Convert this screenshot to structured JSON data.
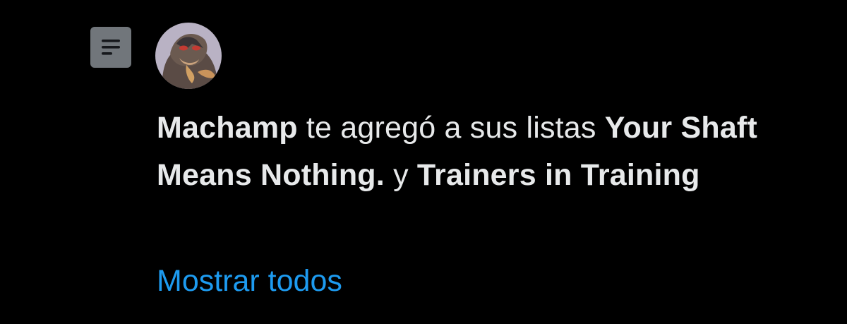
{
  "colors": {
    "background": "#000000",
    "text": "#e7e9ea",
    "link": "#1d9bf0",
    "badge_bg": "#71767b",
    "badge_lines": "#16181c"
  },
  "icons": {
    "badge": "list-icon",
    "avatar": "user-avatar"
  },
  "notification": {
    "actor": "Machamp",
    "action_text": " te agregó a sus listas ",
    "list_1": "Your Shaft Means Nothing.",
    "conjunction": " y ",
    "list_2": "Trainers in Training",
    "show_all": "Mostrar todos"
  }
}
